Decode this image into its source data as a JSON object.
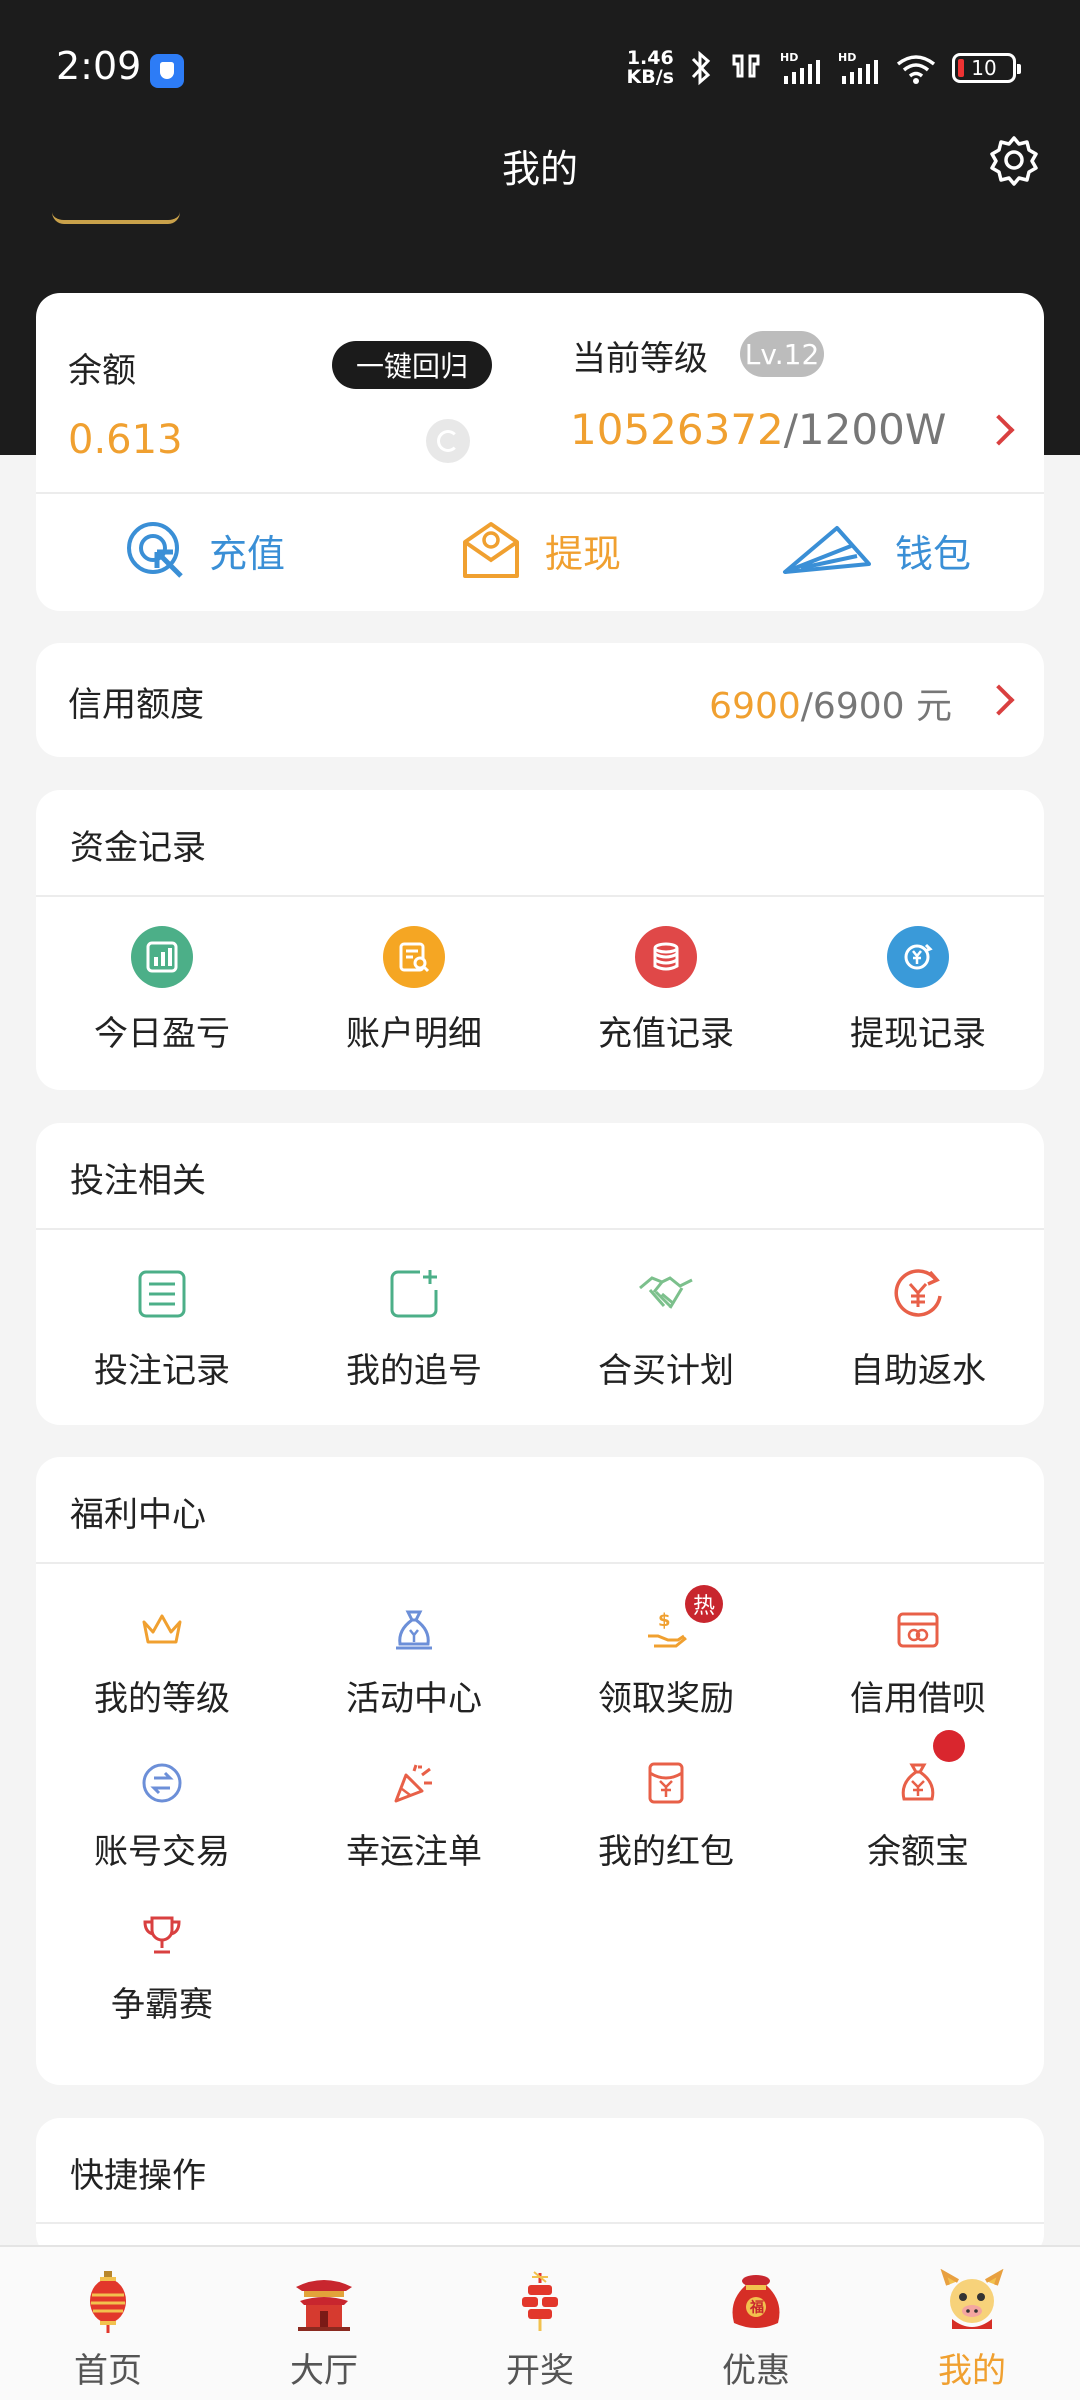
{
  "status_bar": {
    "time": "2:09",
    "net_speed_value": "1.46",
    "net_speed_unit": "KB/s",
    "battery": "10"
  },
  "header": {
    "title": "我的"
  },
  "balance_card": {
    "balance_label": "余额",
    "balance_value": "0.613",
    "one_key_return": "一键回归",
    "level_label": "当前等级",
    "level_badge": "Lv.12",
    "level_progress_current": "10526372",
    "level_progress_total": "/1200W",
    "quick_actions": [
      {
        "label": "充值",
        "icon": "recharge-icon",
        "color": "#3a8fd6"
      },
      {
        "label": "提现",
        "icon": "withdraw-icon",
        "color": "#f0a030"
      },
      {
        "label": "钱包",
        "icon": "wallet-icon",
        "color": "#3a8fd6"
      }
    ]
  },
  "credit": {
    "label": "信用额度",
    "current": "6900",
    "total": "/6900 元"
  },
  "fund_records": {
    "title": "资金记录",
    "items": [
      {
        "label": "今日盈亏",
        "icon": "chart-icon",
        "color": "#4caf88"
      },
      {
        "label": "账户明细",
        "icon": "statement-icon",
        "color": "#f5a623"
      },
      {
        "label": "充值记录",
        "icon": "coins-icon",
        "color": "#e04848"
      },
      {
        "label": "提现记录",
        "icon": "yen-cycle-icon",
        "color": "#3a9ad9"
      }
    ]
  },
  "betting": {
    "title": "投注相关",
    "items": [
      {
        "label": "投注记录",
        "icon": "list-icon"
      },
      {
        "label": "我的追号",
        "icon": "add-note-icon"
      },
      {
        "label": "合买计划",
        "icon": "handshake-icon"
      },
      {
        "label": "自助返水",
        "icon": "yen-refresh-icon"
      }
    ]
  },
  "welfare": {
    "title": "福利中心",
    "hot_badge": "热",
    "items": [
      {
        "label": "我的等级",
        "icon": "crown-icon"
      },
      {
        "label": "活动中心",
        "icon": "money-bag-icon"
      },
      {
        "label": "领取奖励",
        "icon": "reward-hand-icon"
      },
      {
        "label": "信用借呗",
        "icon": "credit-card-icon"
      },
      {
        "label": "账号交易",
        "icon": "exchange-icon"
      },
      {
        "label": "幸运注单",
        "icon": "party-popper-icon"
      },
      {
        "label": "我的红包",
        "icon": "red-envelope-icon"
      },
      {
        "label": "余额宝",
        "icon": "yen-bag-icon"
      },
      {
        "label": "争霸赛",
        "icon": "trophy-icon"
      }
    ]
  },
  "shortcuts": {
    "title": "快捷操作"
  },
  "tab_bar": {
    "tabs": [
      {
        "label": "首页",
        "icon": "lantern-icon"
      },
      {
        "label": "大厅",
        "icon": "temple-icon"
      },
      {
        "label": "开奖",
        "icon": "firecracker-icon"
      },
      {
        "label": "优惠",
        "icon": "lucky-bag-icon"
      },
      {
        "label": "我的",
        "icon": "mascot-icon"
      }
    ],
    "active_color": "#f0a030"
  }
}
